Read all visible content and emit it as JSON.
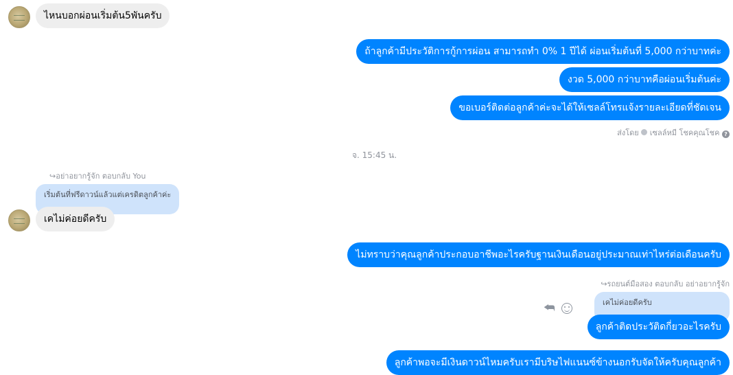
{
  "messages": {
    "m1": "ไหนบอกผ่อนเริ่มต้น5พันครับ",
    "m2": "ถ้าลูกค้ามีประวัติการกู้การผ่อน สามารถทำ 0% 1 ปีได้ ผ่อนเริ่มต้นที่ 5,000 กว่าบาทค่ะ",
    "m3": "งวด 5,000 กว่าบาทคือผ่อนเริ่มต้นค่ะ",
    "m4": "ขอเบอร์ติดต่อลูกค้าค่ะจะได้ให้เซลล์โทรแจ้งรายละเอียดที่ชัดเจน",
    "sent_by_prefix": "ส่งโดย",
    "sent_by_name": "เซลล์หมี โชคคุณโชค",
    "timestamp": "จ. 15:45 น.",
    "reply1_meta": "อย่าอยากรู้จัก ตอบกลับ You",
    "reply1_quote": "เริ่มต้นที่ฟรีดาวน์แล้วแต่เครดิตลูกค้าค่ะ",
    "m5": "เคไม่ค่อยดีครับ",
    "m6": "ไม่ทราบว่าคุณลูกค้าประกอบอาชีพอะไรครับฐานเงินเดือนอยู่ประมาณเท่าไหร่ต่อเดือนครับ",
    "reply2_meta": "รถยนต์มือสอง ตอบกลับ อย่าอยากรู้จัก",
    "reply2_quote": "เคไม่ค่อยดีครับ",
    "m7": "ลูกค้าติดประวัติดกี่ยวอะไรครับ",
    "m8": "ลูกค้าพอจะมีเงินดาวน์ไหมครับเรามีบริษไฟแนนซ์ข้างนอกรับจัดให้ครับคุณลูกค้า"
  },
  "icons": {
    "reply": "reply-icon",
    "emoji": "smile-icon",
    "help": "help-icon",
    "seen": "dot-icon"
  },
  "colors": {
    "outgoing": "#0084ff",
    "incoming": "#eeeeee",
    "quote": "#cfe3fb"
  }
}
